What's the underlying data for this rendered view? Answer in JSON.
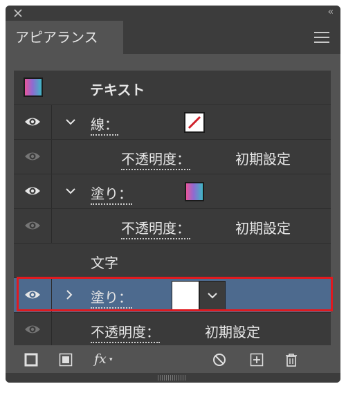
{
  "panel": {
    "tab_title": "アピアランス",
    "icons": {
      "close": "close-icon",
      "collapse": "collapse-chevrons-icon",
      "menu": "panel-menu-icon"
    }
  },
  "rows": {
    "object": {
      "label": "テキスト"
    },
    "stroke": {
      "label": "線："
    },
    "stroke_opacity": {
      "label": "不透明度：",
      "value": "初期設定"
    },
    "fill": {
      "label": "塗り："
    },
    "fill_opacity": {
      "label": "不透明度：",
      "value": "初期設定"
    },
    "characters": {
      "label": "文字"
    },
    "char_fill": {
      "label": "塗り："
    },
    "char_opacity": {
      "label": "不透明度：",
      "value": "初期設定"
    }
  },
  "toolbar": {
    "fx_label": "fx",
    "icons": [
      "add-new-stroke-icon",
      "add-new-fill-icon",
      "add-effect-icon",
      "clear-appearance-icon",
      "duplicate-item-icon",
      "delete-icon"
    ]
  },
  "colors": {
    "panel_bg": "#535353",
    "list_bg": "#3a3a3a",
    "selected_row": "#4d6a8e",
    "highlight_border": "#e01a1f",
    "gradient": [
      "#e8559b",
      "#8f6ad0",
      "#3fb6c5"
    ]
  }
}
